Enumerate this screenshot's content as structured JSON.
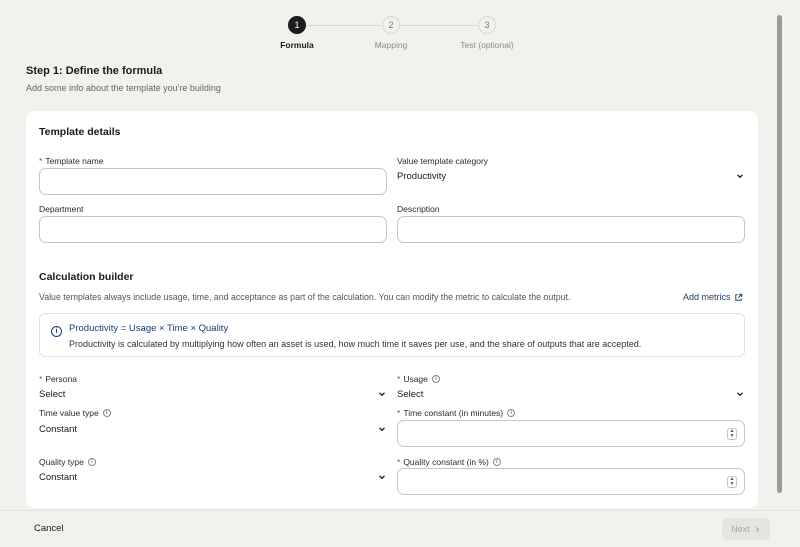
{
  "stepper": {
    "steps": [
      {
        "number": "1",
        "label": "Formula"
      },
      {
        "number": "2",
        "label": "Mapping"
      },
      {
        "number": "3",
        "label": "Test (optional)"
      }
    ],
    "active_step": 1
  },
  "header": {
    "title": "Step 1: Define the formula",
    "subtitle": "Add some info about the template you're building"
  },
  "template_details": {
    "title": "Template details",
    "required_marker": "*",
    "template_name": {
      "label": "Template name",
      "value": ""
    },
    "value_template_category": {
      "label": "Value template category",
      "value": "Productivity"
    },
    "department": {
      "label": "Department",
      "value": ""
    },
    "description": {
      "label": "Description",
      "value": ""
    }
  },
  "calculation_builder": {
    "title": "Calculation builder",
    "description": "Value templates always include usage, time, and acceptance as part of the calculation. You can modify the metric to calculate the output.",
    "add_metrics_label": "Add metrics",
    "info_box": {
      "title": "Productivity = Usage × Time × Quality",
      "text": "Productivity is calculated by multiplying how often an asset is used, how much time it saves per use, and the share of outputs that are accepted."
    },
    "persona": {
      "label": "Persona",
      "value": "Select"
    },
    "usage": {
      "label": "Usage",
      "value": "Select"
    },
    "time_value_type": {
      "label": "Time value type",
      "value": "Constant"
    },
    "time_constant": {
      "label": "Time constant (in minutes)",
      "value": ""
    },
    "quality_type": {
      "label": "Quality type",
      "value": "Constant"
    },
    "quality_constant": {
      "label": "Quality constant (in %)",
      "value": ""
    }
  },
  "footer": {
    "cancel_label": "Cancel",
    "next_label": "Next"
  },
  "colors": {
    "page_background": "#f2f1ee",
    "card_background": "#ffffff",
    "active_step": "#1c1c1c",
    "link": "#1a3e6e",
    "required": "#c0392b"
  }
}
